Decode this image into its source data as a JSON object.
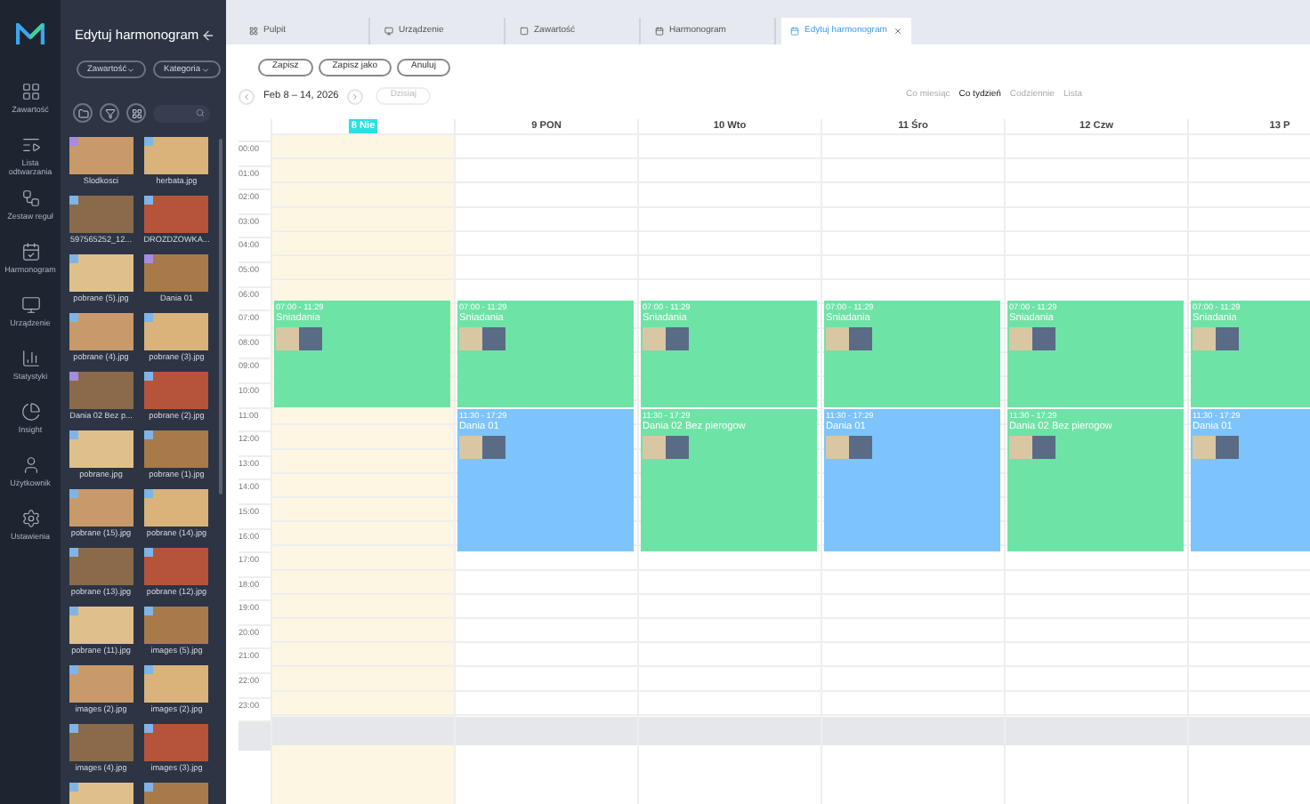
{
  "nav": {
    "items": [
      {
        "label": "Zawartość"
      },
      {
        "label": "Lista odtwarzania"
      },
      {
        "label": "Zestaw reguł"
      },
      {
        "label": "Harmonogram"
      },
      {
        "label": "Urządzenie"
      },
      {
        "label": "Statystyki"
      },
      {
        "label": "Insight"
      },
      {
        "label": "Użytkownik"
      },
      {
        "label": "Ustawienia"
      }
    ]
  },
  "library": {
    "title": "Edytuj harmonogram",
    "filters": [
      "Zawartość",
      "Kategoria"
    ],
    "items": [
      {
        "label": "Slodkosci",
        "kind": "playlist"
      },
      {
        "label": "herbata.jpg",
        "kind": "image"
      },
      {
        "label": "597565252_12...",
        "kind": "image"
      },
      {
        "label": "DROZDZOWKA...",
        "kind": "image"
      },
      {
        "label": "pobrane (5).jpg",
        "kind": "image"
      },
      {
        "label": "Dania 01",
        "kind": "playlist"
      },
      {
        "label": "pobrane (4).jpg",
        "kind": "image"
      },
      {
        "label": "pobrane (3).jpg",
        "kind": "image"
      },
      {
        "label": "Dania 02 Bez p...",
        "kind": "playlist"
      },
      {
        "label": "pobrane (2).jpg",
        "kind": "image"
      },
      {
        "label": "pobrane.jpg",
        "kind": "image"
      },
      {
        "label": "pobrane (1).jpg",
        "kind": "image"
      },
      {
        "label": "pobrane (15).jpg",
        "kind": "image"
      },
      {
        "label": "pobrane (14).jpg",
        "kind": "image"
      },
      {
        "label": "pobrane (13).jpg",
        "kind": "image"
      },
      {
        "label": "pobrane (12).jpg",
        "kind": "image"
      },
      {
        "label": "pobrane (11).jpg",
        "kind": "image"
      },
      {
        "label": "images (5).jpg",
        "kind": "image"
      },
      {
        "label": "images (2).jpg",
        "kind": "image"
      },
      {
        "label": "images (2).jpg",
        "kind": "image"
      },
      {
        "label": "images (4).jpg",
        "kind": "image"
      },
      {
        "label": "images (3).jpg",
        "kind": "image"
      },
      {
        "kind": "image"
      },
      {
        "kind": "image"
      }
    ]
  },
  "tabs": [
    {
      "label": "Pulpit",
      "selected": false
    },
    {
      "label": "Urządzenie",
      "selected": false
    },
    {
      "label": "Zawartość",
      "selected": false
    },
    {
      "label": "Harmonogram",
      "selected": false
    },
    {
      "label": "Edytuj harmonogram",
      "selected": true
    }
  ],
  "toolbar": {
    "buttons": [
      "Zapisz",
      "Zapisz jako",
      "Anuluj"
    ]
  },
  "date_nav": {
    "range": "Feb 8 – 14, 2026",
    "today_button": {
      "label": "Dzisiaj",
      "disabled": true
    }
  },
  "views": [
    {
      "label": "Co miesiąc",
      "selected": false
    },
    {
      "label": "Co tydzień",
      "selected": true
    },
    {
      "label": "Codziennie",
      "selected": false
    },
    {
      "label": "Lista",
      "selected": false
    }
  ],
  "calendar": {
    "hours": [
      "00:00",
      "01:00",
      "02:00",
      "03:00",
      "04:00",
      "05:00",
      "06:00",
      "07:00",
      "08:00",
      "09:00",
      "10:00",
      "11:00",
      "12:00",
      "13:00",
      "14:00",
      "15:00",
      "16:00",
      "17:00",
      "18:00",
      "19:00",
      "20:00",
      "21:00",
      "22:00",
      "23:00"
    ],
    "days": [
      {
        "label": "8 Nie",
        "today": true,
        "events": [
          {
            "time": "07:00 - 11:29",
            "title": "Sniadania",
            "kind": "morning",
            "color": "#6ee3a6"
          }
        ]
      },
      {
        "label": "9 PON",
        "today": false,
        "events": [
          {
            "time": "07:00 - 11:29",
            "title": "Sniadania",
            "kind": "morning",
            "color": "#6ee3a6"
          },
          {
            "time": "11:30 - 17:29",
            "title": "Dania 01",
            "kind": "afternoon",
            "color": "#7cc4fb"
          }
        ]
      },
      {
        "label": "10 Wto",
        "today": false,
        "events": [
          {
            "time": "07:00 - 11:29",
            "title": "Sniadania",
            "kind": "morning",
            "color": "#6ee3a6"
          },
          {
            "time": "11:30 - 17:29",
            "title": "Dania 02 Bez pierogow",
            "kind": "afternoon",
            "color": "#6ee3a6"
          }
        ]
      },
      {
        "label": "11 Śro",
        "today": false,
        "events": [
          {
            "time": "07:00 - 11:29",
            "title": "Sniadania",
            "kind": "morning",
            "color": "#6ee3a6"
          },
          {
            "time": "11:30 - 17:29",
            "title": "Dania 01",
            "kind": "afternoon",
            "color": "#7cc4fb"
          }
        ]
      },
      {
        "label": "12 Czw",
        "today": false,
        "events": [
          {
            "time": "07:00 - 11:29",
            "title": "Sniadania",
            "kind": "morning",
            "color": "#6ee3a6"
          },
          {
            "time": "11:30 - 17:29",
            "title": "Dania 02 Bez pierogow",
            "kind": "afternoon",
            "color": "#6ee3a6"
          }
        ]
      },
      {
        "label": "13 P",
        "today": false,
        "events": [
          {
            "time": "07:00 - 11:29",
            "title": "Sniadania",
            "kind": "morning",
            "color": "#6ee3a6"
          },
          {
            "time": "11:30 - 17:29",
            "title": "Dania 01",
            "kind": "afternoon",
            "color": "#7cc4fb"
          }
        ]
      }
    ]
  }
}
